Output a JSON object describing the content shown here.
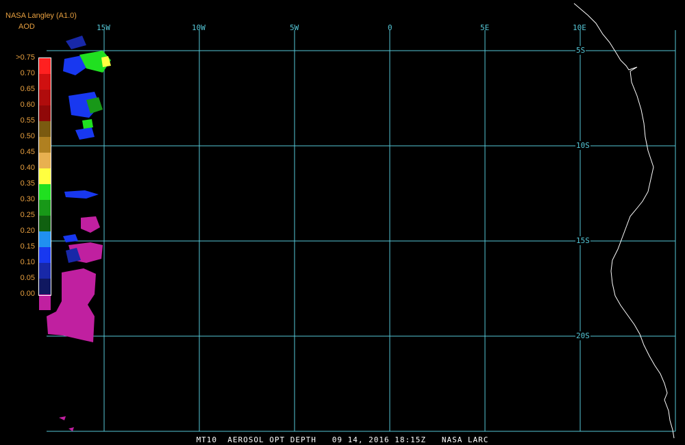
{
  "header": {
    "title": "NASA Langley (A1.0)",
    "variable": "AOD"
  },
  "colorbar": {
    "levels": [
      {
        "label": ">0.75",
        "color": "#ff2020"
      },
      {
        "label": "0.70",
        "color": "#d01010"
      },
      {
        "label": "0.65",
        "color": "#b00c0c"
      },
      {
        "label": "0.60",
        "color": "#900808"
      },
      {
        "label": "0.55",
        "color": "#7a5a10"
      },
      {
        "label": "0.50",
        "color": "#b08020"
      },
      {
        "label": "0.45",
        "color": "#e8b050"
      },
      {
        "label": "0.40",
        "color": "#ffff40"
      },
      {
        "label": "0.35",
        "color": "#20e020"
      },
      {
        "label": "0.30",
        "color": "#189818"
      },
      {
        "label": "0.25",
        "color": "#106010"
      },
      {
        "label": "0.20",
        "color": "#2090f0"
      },
      {
        "label": "0.15",
        "color": "#1838f0"
      },
      {
        "label": "0.10",
        "color": "#1828a8"
      },
      {
        "label": "0.05",
        "color": "#101860"
      },
      {
        "label": "0.00",
        "color": "#c020a0"
      }
    ]
  },
  "grid": {
    "lon_labels": [
      "15W",
      "10W",
      "5W",
      "0",
      "5E",
      "10E"
    ],
    "lat_labels": [
      "5S",
      "10S",
      "15S",
      "20S"
    ],
    "color": "#56c8d8"
  },
  "coastline_color": "#ffffff",
  "footer": "MT10  AEROSOL OPT DEPTH   09 14, 2016 18:15Z   NASA LARC"
}
